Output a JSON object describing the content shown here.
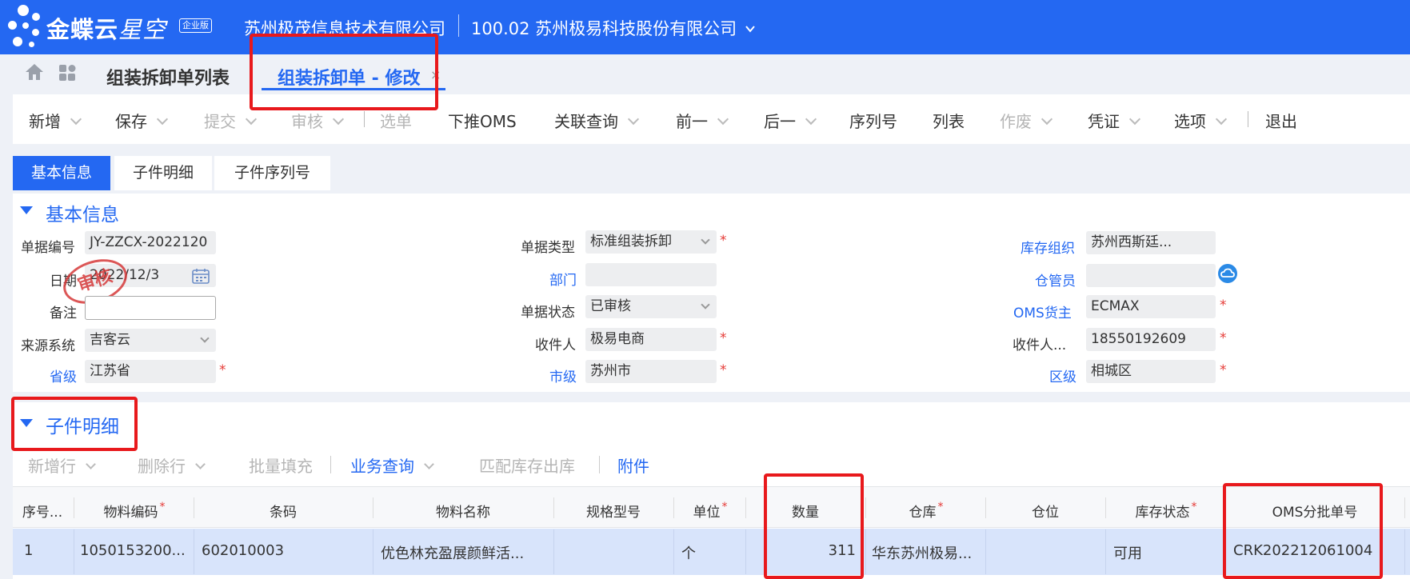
{
  "header": {
    "brand_main": "金蝶云",
    "brand_sub": "星空",
    "edition": "企业版",
    "company_org": "苏州极茂信息技术有限公司",
    "company_account": "100.02 苏州极易科技股份有限公司"
  },
  "page_tabs": {
    "list_tab": "组装拆卸单列表",
    "edit_tab": "组装拆卸单 - 修改",
    "close": "×"
  },
  "toolbar": {
    "items": [
      {
        "label": "新增",
        "enabled": true
      },
      {
        "label": "保存",
        "enabled": true
      },
      {
        "label": "提交",
        "enabled": false
      },
      {
        "label": "审核",
        "enabled": false
      },
      {
        "label": "选单",
        "enabled": false
      },
      {
        "label": "下推OMS",
        "enabled": true
      },
      {
        "label": "关联查询",
        "enabled": true
      },
      {
        "label": "前一",
        "enabled": true
      },
      {
        "label": "后一",
        "enabled": true
      },
      {
        "label": "序列号",
        "enabled": true
      },
      {
        "label": "列表",
        "enabled": true
      },
      {
        "label": "作废",
        "enabled": false
      },
      {
        "label": "凭证",
        "enabled": true
      },
      {
        "label": "选项",
        "enabled": true
      },
      {
        "label": "退出",
        "enabled": true
      }
    ]
  },
  "section_tabs": [
    "基本信息",
    "子件明细",
    "子件序列号"
  ],
  "basic_info": {
    "title": "基本信息",
    "stamp": "审核",
    "fields": {
      "bill_no": {
        "label": "单据编号",
        "value": "JY-ZZCX-2022120"
      },
      "date": {
        "label": "日期",
        "value": "2022/12/3"
      },
      "remark": {
        "label": "备注",
        "value": ""
      },
      "source_system": {
        "label": "来源系统",
        "value": "吉客云"
      },
      "province": {
        "label": "省级",
        "value": "江苏省"
      },
      "bill_type": {
        "label": "单据类型",
        "value": "标准组装拆卸"
      },
      "department": {
        "label": "部门",
        "value": ""
      },
      "bill_status": {
        "label": "单据状态",
        "value": "已审核"
      },
      "receiver": {
        "label": "收件人",
        "value": "极易电商"
      },
      "city": {
        "label": "市级",
        "value": "苏州市"
      },
      "stock_org": {
        "label": "库存组织",
        "value": "苏州西斯廷..."
      },
      "keeper": {
        "label": "仓管员",
        "value": ""
      },
      "oms_owner": {
        "label": "OMS货主",
        "value": "ECMAX"
      },
      "receiver_phone": {
        "label": "收件人...",
        "value": "18550192609"
      },
      "district": {
        "label": "区级",
        "value": "相城区"
      }
    },
    "required_mark": "*"
  },
  "child_detail": {
    "title": "子件明细",
    "toolbar": [
      {
        "label": "新增行",
        "enabled": false
      },
      {
        "label": "删除行",
        "enabled": false
      },
      {
        "label": "批量填充",
        "enabled": false
      },
      {
        "label": "业务查询",
        "enabled": true
      },
      {
        "label": "匹配库存出库",
        "enabled": false
      },
      {
        "label": "附件",
        "enabled": true
      }
    ],
    "columns": [
      "序号...",
      "物料编码",
      "条码",
      "物料名称",
      "规格型号",
      "单位",
      "数量",
      "仓库",
      "仓位",
      "库存状态",
      "OMS分批单号"
    ],
    "rows": [
      {
        "seq": "1",
        "material_code": "1050153200...",
        "barcode": "602010003",
        "material_name": "优色林充盈展颜鲜活...",
        "spec": "",
        "unit": "个",
        "qty": "311",
        "warehouse": "华东苏州极易...",
        "location": "",
        "stock_status": "可用",
        "oms_batch_no": "CRK202212061004"
      }
    ]
  }
}
